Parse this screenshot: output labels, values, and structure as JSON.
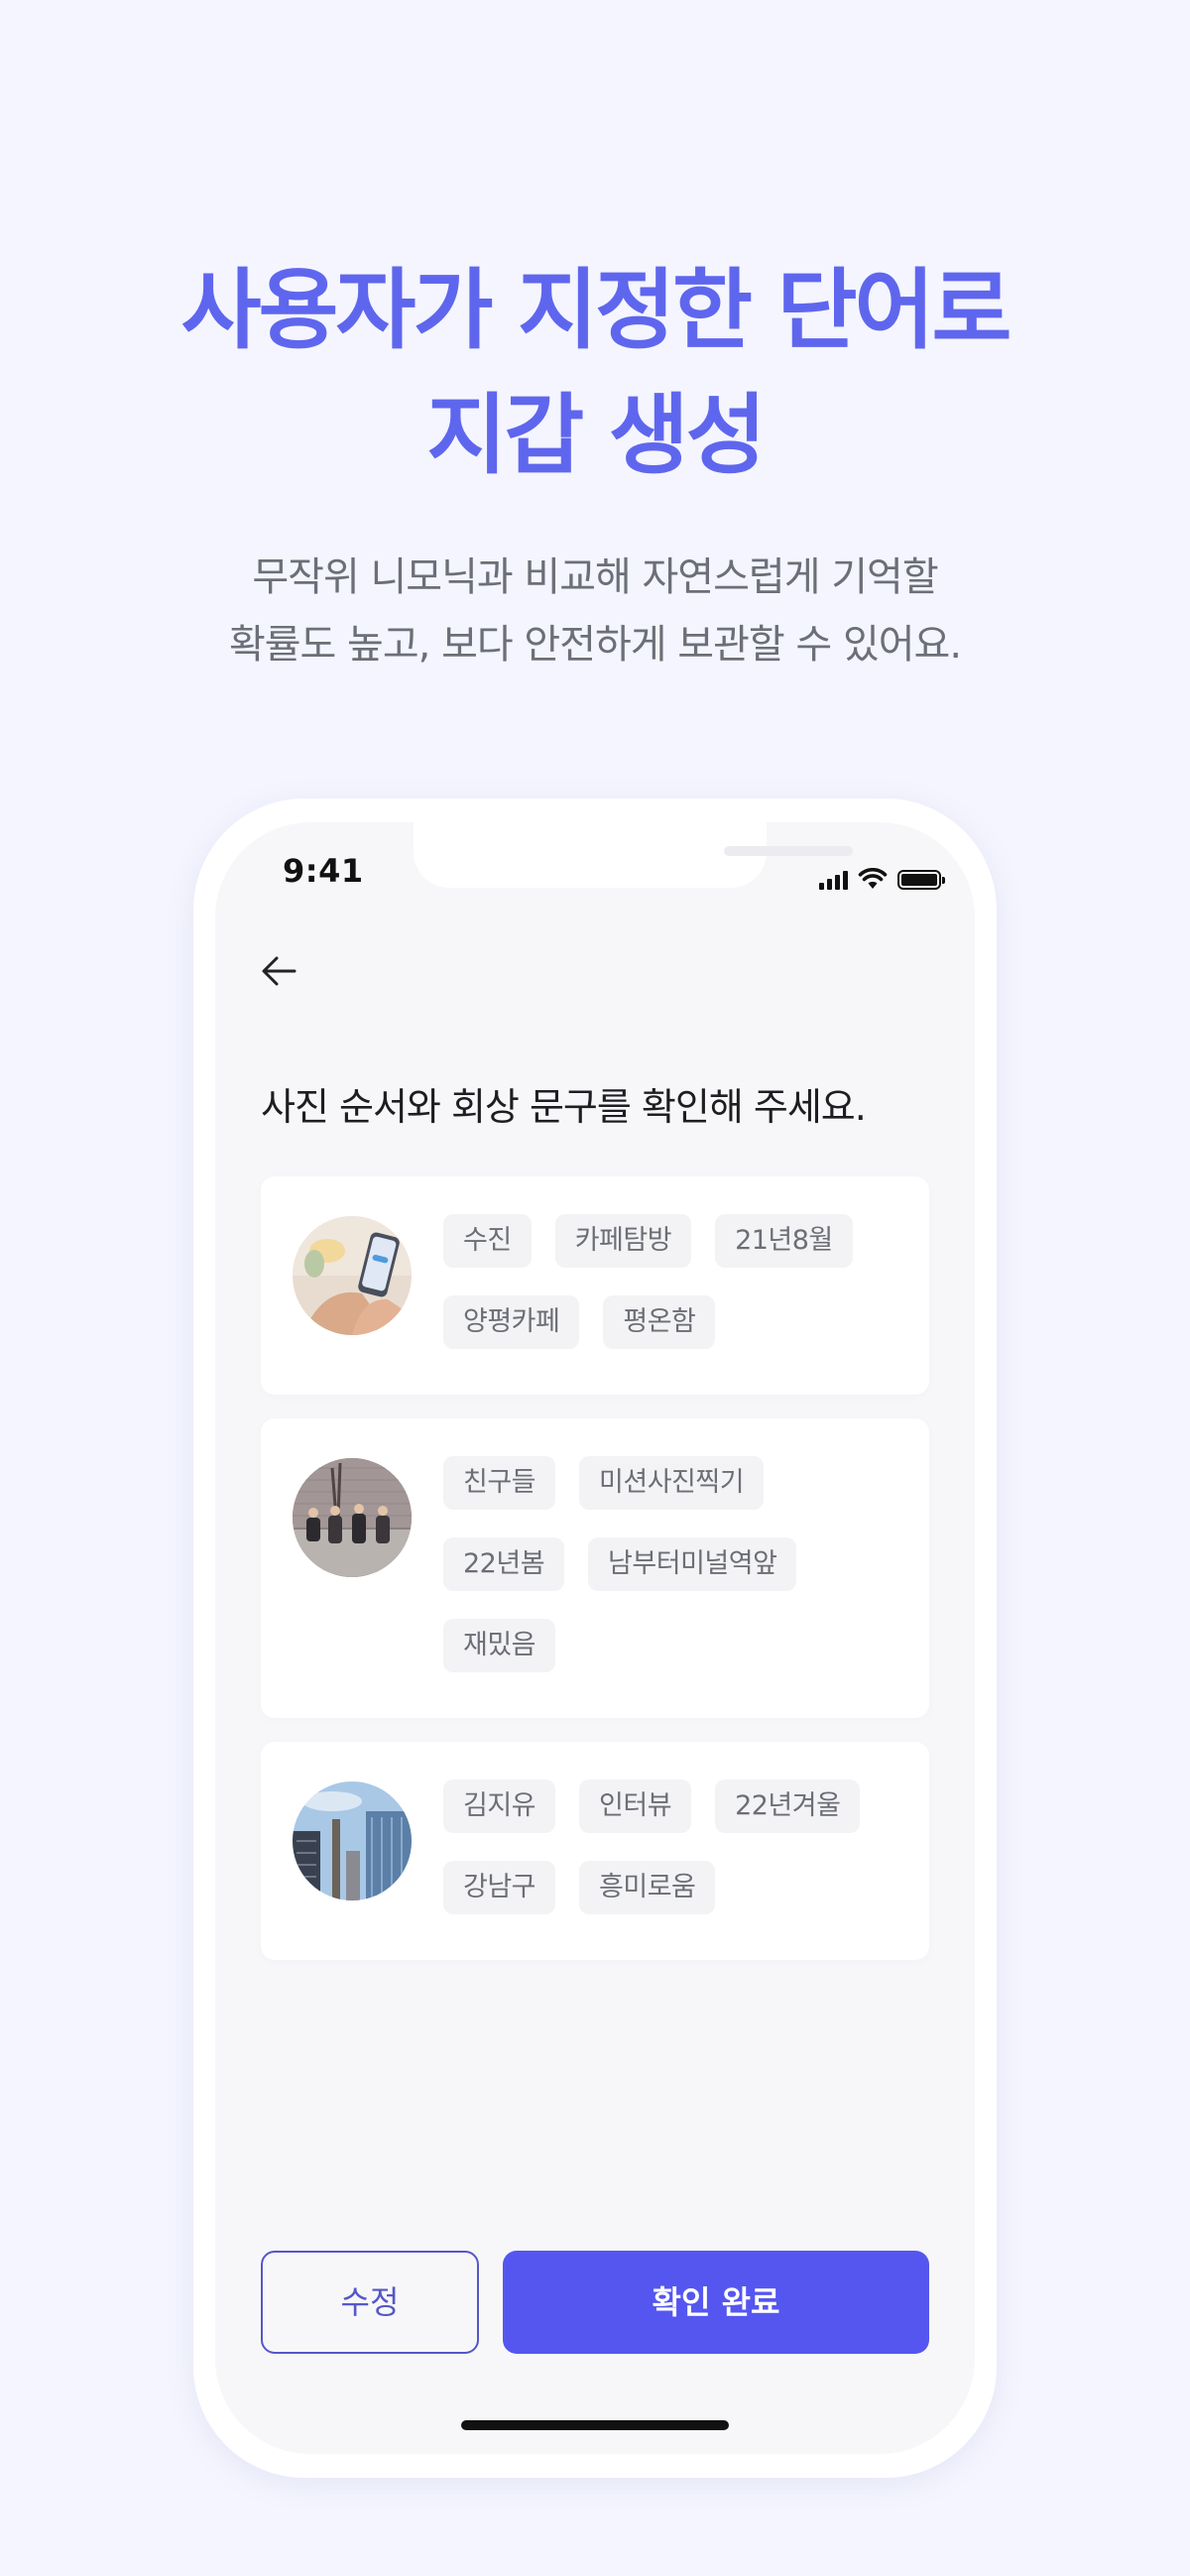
{
  "hero": {
    "headline_line1": "사용자가 지정한 단어로",
    "headline_line2": "지갑 생성",
    "subtext_line1": "무작위 니모닉과 비교해 자연스럽게 기억할",
    "subtext_line2": "확률도 높고, 보다 안전하게 보관할 수 있어요."
  },
  "status_bar": {
    "time": "9:41"
  },
  "screen": {
    "title": "사진 순서와 회상 문구를 확인해 주세요.",
    "cards": [
      {
        "rows": [
          [
            "수진",
            "카페탐방",
            "21년8월"
          ],
          [
            "양평카페",
            "평온함"
          ]
        ]
      },
      {
        "rows": [
          [
            "친구들",
            "미션사진찍기"
          ],
          [
            "22년봄",
            "남부터미널역앞"
          ],
          [
            "재밌음"
          ]
        ]
      },
      {
        "rows": [
          [
            "김지유",
            "인터뷰",
            "22년겨울"
          ],
          [
            "강남구",
            "흥미로움"
          ]
        ]
      }
    ],
    "edit_label": "수정",
    "confirm_label": "확인 완료"
  },
  "colors": {
    "accent": "#5556f0",
    "headline": "#5f66ee",
    "background": "#f4f5fe"
  }
}
